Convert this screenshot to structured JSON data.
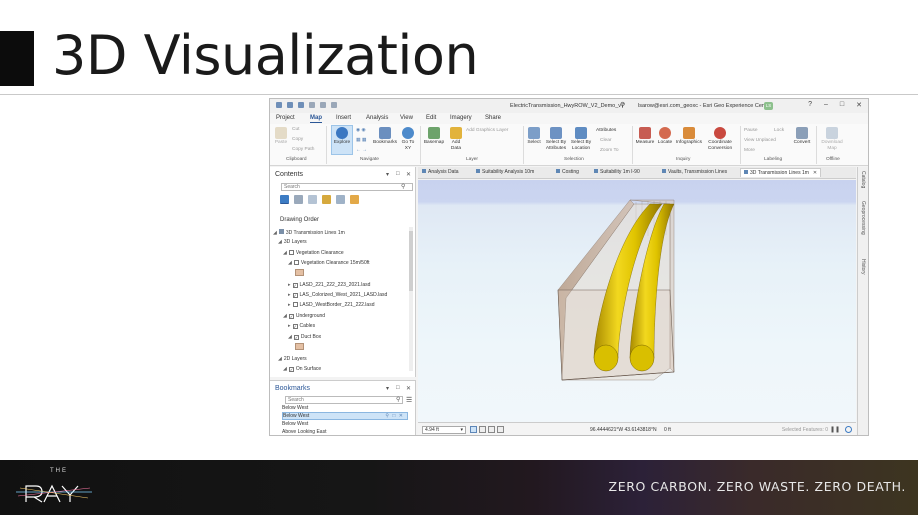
{
  "slide": {
    "title": "3D Visualization",
    "footer_tagline": "ZERO CARBON. ZERO WASTE. ZERO DEATH.",
    "logo_text": "THE",
    "logo_word": "RAY"
  },
  "app": {
    "document_title": "ElectricTransmission_HwyROW_V2_Demo_v7",
    "user": "lsarow@esri.com_geoxc - Esri Geo Experience Center",
    "user_initials": "LS",
    "ribbon_tabs": [
      "Project",
      "Map",
      "Insert",
      "Analysis",
      "View",
      "Edit",
      "Imagery",
      "Share"
    ],
    "active_tab": "Map",
    "ribbon": {
      "clipboard": {
        "paste": "Paste",
        "cut": "Cut",
        "copy": "Copy",
        "copy_path": "Copy Path",
        "group": "Clipboard"
      },
      "navigate": {
        "explore": "Explore",
        "bookmarks": "Bookmarks",
        "goto": "Go To XY",
        "group": "Navigate"
      },
      "layer": {
        "basemap": "Basemap",
        "add_data": "Add Data",
        "add_graphics": "Add Graphics Layer",
        "group": "Layer"
      },
      "selection": {
        "select": "Select",
        "by_attributes": "Select By Attributes",
        "by_location": "Select By Location",
        "attributes": "Attributes",
        "clear": "Clear",
        "zoom_to": "Zoom To",
        "group": "Selection"
      },
      "inquiry": {
        "measure": "Measure",
        "locate": "Locate",
        "infographics": "Infographics",
        "coordinate_conversion": "Coordinate Conversion",
        "group": "Inquiry"
      },
      "labeling": {
        "pause": "Pause",
        "lock": "Lock",
        "view_unplaced": "View Unplaced",
        "more": "More",
        "convert": "Convert",
        "group": "Labeling"
      },
      "offline": {
        "download_map": "Download Map",
        "group": "Offline"
      }
    },
    "contents": {
      "title": "Contents",
      "search_placeholder": "Search",
      "drawing_order": "Drawing Order",
      "tree": [
        "3D Transmission Lines 1m",
        "3D Layers",
        "Vegetation Clearance",
        "Vegetation Clearance 15m/50ft",
        "LASD_221_222_223_2021.lasd",
        "LAS_Colorized_West_2021_LASD.lasd",
        "LASD_WestBorder_221_222.lasd",
        "Underground",
        "Cables",
        "Duct Box",
        "2D Layers",
        "On Surface"
      ]
    },
    "bookmarks": {
      "title": "Bookmarks",
      "search_placeholder": "Search",
      "items": [
        "Below West",
        "Below West",
        "Below West",
        "Above Looking East"
      ]
    },
    "doc_tabs": [
      "Analysis Data",
      "Suitability Analysis 10m",
      "Costing",
      "Suitability 1m I-90",
      "Vaults, Transmission Lines",
      "3D Transmission Lines 1m"
    ],
    "active_doc_tab": "3D Transmission Lines 1m",
    "status": {
      "scale": "4.94 ft",
      "coordinates": "96.4444621°W 43.6143818°N",
      "elevation": "0 ft",
      "selected_features": "Selected Features: 0"
    },
    "side_tabs": [
      "Catalog",
      "Geoprocessing",
      "History"
    ]
  }
}
